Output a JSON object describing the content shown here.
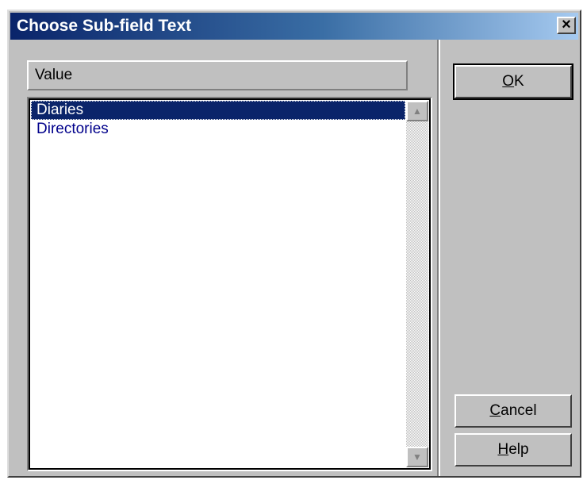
{
  "dialog": {
    "title": "Choose Sub-field Text",
    "close_label": "×"
  },
  "list": {
    "column_header": "Value",
    "items": [
      {
        "label": "Diaries",
        "selected": true
      },
      {
        "label": "Directories",
        "selected": false
      }
    ]
  },
  "scrollbar": {
    "up_arrow": "▲",
    "down_arrow": "▼"
  },
  "buttons": {
    "ok": {
      "accel": "O",
      "rest": "K"
    },
    "cancel": {
      "accel": "C",
      "rest": "ancel"
    },
    "help": {
      "accel": "H",
      "rest": "elp"
    }
  },
  "colors": {
    "titlebar_start": "#0a246a",
    "titlebar_end": "#a6caf0",
    "selection": "#0a246a",
    "list_text": "#00008b",
    "face": "#c0c0c0"
  }
}
